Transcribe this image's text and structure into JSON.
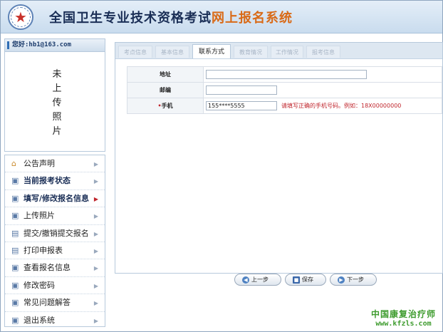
{
  "header": {
    "title_main": "全国卫生专业技术资格考试",
    "title_accent": "网上报名系统",
    "logo_icon": "star-emblem-icon"
  },
  "user": {
    "greeting": "您好:hb1@163.com",
    "photo_lines": [
      "未",
      "上",
      "传",
      "照",
      "片"
    ]
  },
  "menu": {
    "items": [
      {
        "label": "公告声明",
        "icon": "home-icon"
      },
      {
        "label": "当前报考状态",
        "icon": "status-icon"
      },
      {
        "label": "填写/修改报名信息",
        "icon": "edit-icon"
      },
      {
        "label": "上传照片",
        "icon": "upload-icon"
      },
      {
        "label": "提交/撤销提交报名",
        "icon": "document-icon"
      },
      {
        "label": "打印申报表",
        "icon": "print-icon"
      },
      {
        "label": "查看报名信息",
        "icon": "view-icon"
      },
      {
        "label": "修改密码",
        "icon": "key-icon"
      },
      {
        "label": "常见问题解答",
        "icon": "help-icon"
      },
      {
        "label": "退出系统",
        "icon": "exit-icon"
      }
    ]
  },
  "tabs": [
    {
      "label": "考点信息",
      "active": false
    },
    {
      "label": "基本信息",
      "active": false
    },
    {
      "label": "联系方式",
      "active": true
    },
    {
      "label": "教育情况",
      "active": false
    },
    {
      "label": "工作情况",
      "active": false
    },
    {
      "label": "报考信息",
      "active": false
    }
  ],
  "form": {
    "address_label": "地址",
    "address_value": "",
    "postcode_label": "邮编",
    "postcode_value": "",
    "required_mark": "•",
    "mobile_label": "手机",
    "mobile_value": "155****5555",
    "mobile_hint": "请填写正确的手机号码。例如：18X00000000"
  },
  "buttons": {
    "prev": "上一步",
    "save": "保存",
    "next": "下一步"
  },
  "brand": {
    "name": "中国康复治疗师",
    "url": "www.kfzls.com"
  },
  "colors": {
    "accent": "#d96a17",
    "title": "#1a2e56",
    "error": "#c0262d",
    "brand": "#3d9b2d"
  }
}
